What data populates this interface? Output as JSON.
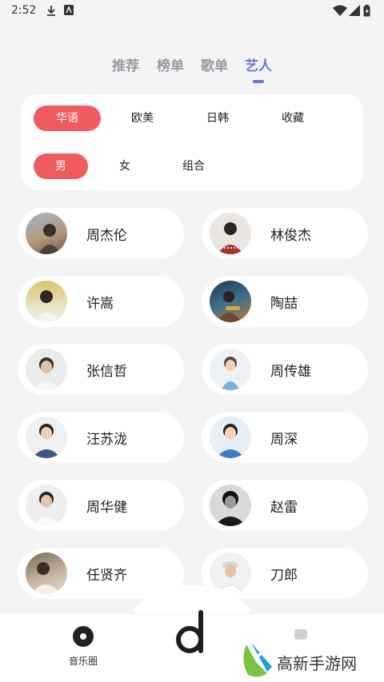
{
  "status_bar": {
    "time": "2:52"
  },
  "tabs": [
    {
      "label": "推荐",
      "active": false
    },
    {
      "label": "榜单",
      "active": false
    },
    {
      "label": "歌单",
      "active": false
    },
    {
      "label": "艺人",
      "active": true
    }
  ],
  "filters": {
    "region": [
      {
        "label": "华语",
        "selected": true
      },
      {
        "label": "欧美",
        "selected": false
      },
      {
        "label": "日韩",
        "selected": false
      },
      {
        "label": "收藏",
        "selected": false
      }
    ],
    "type": [
      {
        "label": "男",
        "selected": true
      },
      {
        "label": "女",
        "selected": false
      },
      {
        "label": "组合",
        "selected": false
      }
    ]
  },
  "artists": [
    {
      "name": "周杰伦"
    },
    {
      "name": "林俊杰"
    },
    {
      "name": "许嵩"
    },
    {
      "name": "陶喆"
    },
    {
      "name": "张信哲"
    },
    {
      "name": "周传雄"
    },
    {
      "name": "汪苏泷"
    },
    {
      "name": "周深"
    },
    {
      "name": "周华健"
    },
    {
      "name": "赵雷"
    },
    {
      "name": "任贤齐"
    },
    {
      "name": "刀郎"
    }
  ],
  "bottom_nav": {
    "music_circle_label": "音乐圈"
  },
  "watermark": {
    "text": "高新手游网"
  },
  "colors": {
    "accent": "#6c74d6",
    "chip_selected": "#ef5b5f"
  }
}
